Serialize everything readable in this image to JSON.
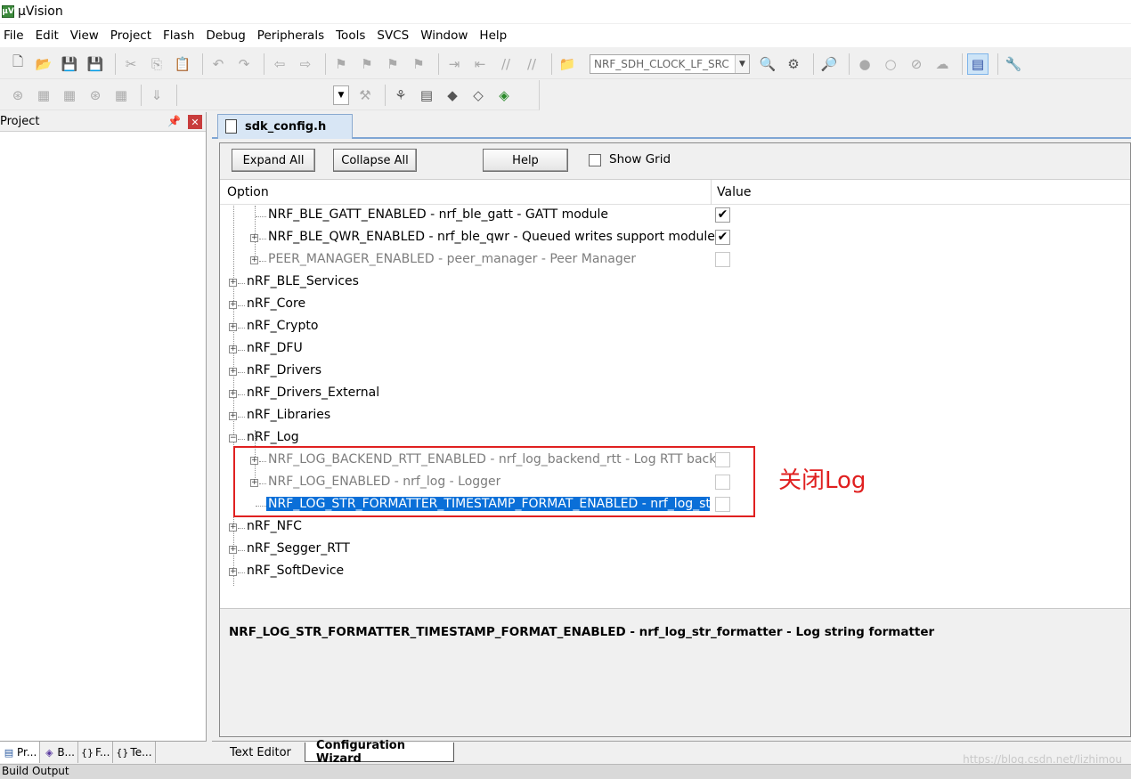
{
  "window": {
    "title": "µVision",
    "app_icon": "keil-icon"
  },
  "menubar": {
    "items": [
      "File",
      "Edit",
      "View",
      "Project",
      "Flash",
      "Debug",
      "Peripherals",
      "Tools",
      "SVCS",
      "Window",
      "Help"
    ]
  },
  "toolbar": {
    "target_combo": "NRF_SDH_CLOCK_LF_SRC"
  },
  "project_panel": {
    "title": "Project",
    "tabs": [
      {
        "label": "Pr...",
        "icon": "project-icon"
      },
      {
        "label": "B...",
        "icon": "books-icon"
      },
      {
        "label": "F...",
        "icon": "functions-icon"
      },
      {
        "label": "Te...",
        "icon": "templates-icon"
      }
    ]
  },
  "editor": {
    "file_tab": "sdk_config.h",
    "buttons": {
      "expand_all": "Expand All",
      "collapse_all": "Collapse All",
      "help": "Help"
    },
    "show_grid": {
      "label": "Show Grid",
      "checked": false
    },
    "columns": {
      "option": "Option",
      "value": "Value"
    },
    "rows": [
      {
        "label": "NRF_BLE_GATT_ENABLED  - nrf_ble_gatt - GATT module",
        "checked": true,
        "enabled": true
      },
      {
        "label": "NRF_BLE_QWR_ENABLED - nrf_ble_qwr - Queued writes support module ...",
        "checked": true,
        "enabled": true
      },
      {
        "label": "PEER_MANAGER_ENABLED - peer_manager - Peer Manager",
        "checked": false,
        "enabled": false
      },
      {
        "label": "nRF_BLE_Services"
      },
      {
        "label": "nRF_Core"
      },
      {
        "label": "nRF_Crypto"
      },
      {
        "label": "nRF_DFU"
      },
      {
        "label": "nRF_Drivers"
      },
      {
        "label": "nRF_Drivers_External"
      },
      {
        "label": "nRF_Libraries"
      },
      {
        "label": "nRF_Log"
      },
      {
        "label": "NRF_LOG_BACKEND_RTT_ENABLED - nrf_log_backend_rtt - Log RTT back...",
        "checked": false,
        "enabled": false
      },
      {
        "label": "NRF_LOG_ENABLED - nrf_log - Logger",
        "checked": false,
        "enabled": false
      },
      {
        "label": "NRF_LOG_STR_FORMATTER_TIMESTAMP_FORMAT_ENABLED  - nrf_log_st...",
        "checked": false,
        "selected": true
      },
      {
        "label": "nRF_NFC"
      },
      {
        "label": "nRF_Segger_RTT"
      },
      {
        "label": "nRF_SoftDevice"
      }
    ],
    "description": "NRF_LOG_STR_FORMATTER_TIMESTAMP_FORMAT_ENABLED  - nrf_log_str_formatter - Log string formatter",
    "bottom_tabs": [
      "Text Editor",
      "Configuration Wizard"
    ]
  },
  "annotation": {
    "text": "关闭Log",
    "color": "#e02020"
  },
  "statusbar": {
    "text": "Build Output"
  },
  "watermark": "https://blog.csdn.net/lizhimou"
}
